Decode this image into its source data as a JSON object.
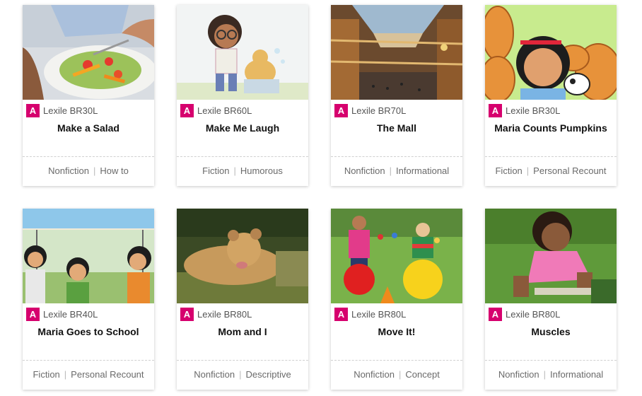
{
  "colors": {
    "badge": "#d6006e"
  },
  "cards": [
    {
      "level": "A",
      "lexile": "Lexile BR30L",
      "title": "Make a Salad",
      "genre": "Nonfiction",
      "type": "How to",
      "image": "salad-photo"
    },
    {
      "level": "A",
      "lexile": "Lexile BR60L",
      "title": "Make Me Laugh",
      "genre": "Fiction",
      "type": "Humorous",
      "image": "girl-washing-dog-illustration"
    },
    {
      "level": "A",
      "lexile": "Lexile BR70L",
      "title": "The Mall",
      "genre": "Nonfiction",
      "type": "Informational",
      "image": "shopping-mall-atrium-photo"
    },
    {
      "level": "A",
      "lexile": "Lexile BR30L",
      "title": "Maria Counts Pumpkins",
      "genre": "Fiction",
      "type": "Personal Recount",
      "image": "girl-with-pumpkins-illustration"
    },
    {
      "level": "A",
      "lexile": "Lexile BR40L",
      "title": "Maria Goes to School",
      "genre": "Fiction",
      "type": "Personal Recount",
      "image": "children-at-school-illustration"
    },
    {
      "level": "A",
      "lexile": "Lexile BR80L",
      "title": "Mom and I",
      "genre": "Nonfiction",
      "type": "Descriptive",
      "image": "lion-cub-photo"
    },
    {
      "level": "A",
      "lexile": "Lexile BR80L",
      "title": "Move It!",
      "genre": "Nonfiction",
      "type": "Concept",
      "image": "kids-on-hopper-balls-photo"
    },
    {
      "level": "A",
      "lexile": "Lexile BR80L",
      "title": "Muscles",
      "genre": "Nonfiction",
      "type": "Informational",
      "image": "girl-doing-pushup-photo"
    }
  ]
}
